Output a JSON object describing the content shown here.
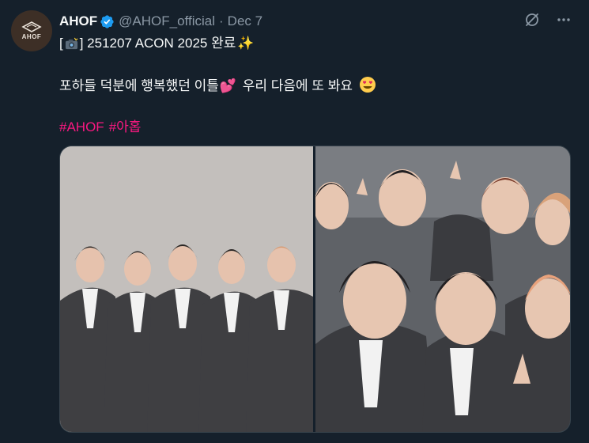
{
  "author": {
    "display_name": "AHOF",
    "handle": "@AHOF_official",
    "date": "Dec 7",
    "avatar_text": "AHOF"
  },
  "tweet": {
    "line1_open": "[",
    "line1_text": "] 251207 ACON 2025 완료",
    "line2_text": "포하들 덕분에 행복했던 이틀",
    "line2_text_after": " 우리 다음에 또 봐요",
    "hashtags": [
      "#AHOF",
      "#아홉"
    ],
    "emojis": {
      "line1_camera": "camera-flash-icon",
      "line1_end": "sparkles-icon",
      "line2_heart": "two-hearts-icon",
      "line2_end": "heart-eyes-icon"
    }
  },
  "actions": {
    "grok_icon": "grok-icon",
    "more_icon": "more-icon"
  },
  "media": {
    "photos": [
      {
        "name": "group-photo-five-members"
      },
      {
        "name": "group-selfie-members"
      }
    ]
  },
  "colors": {
    "background": "#15202b",
    "secondary_text": "#8b98a5",
    "hashtag": "#f91880",
    "verified": "#1d9bf0"
  }
}
